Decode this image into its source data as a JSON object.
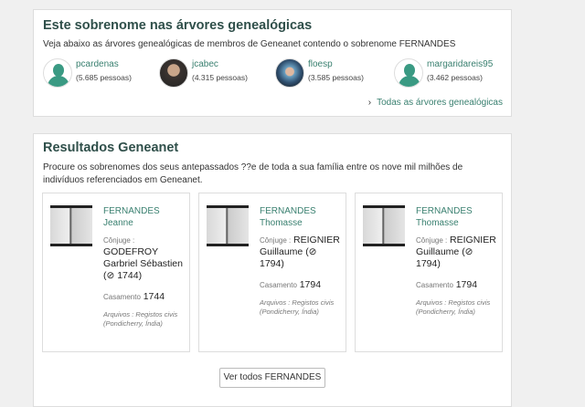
{
  "trees": {
    "title": "Este sobrenome nas árvores genealógicas",
    "description": "Veja abaixo as árvores genealógicas de membros de Geneanet contendo o sobrenome FERNANDES",
    "members": [
      {
        "name": "pcardenas",
        "count": "(5.685 pessoas)",
        "avatar": "default"
      },
      {
        "name": "jcabec",
        "count": "(4.315 pessoas)",
        "avatar": "photo"
      },
      {
        "name": "floesp",
        "count": "(3.585 pessoas)",
        "avatar": "photo"
      },
      {
        "name": "margaridareis95",
        "count": "(3.462 pessoas)",
        "avatar": "default"
      }
    ],
    "all_link": "Todas as árvores genealógicas"
  },
  "results": {
    "title": "Resultados Geneanet",
    "description": "Procure os sobrenomes dos seus antepassados ??e de toda a sua família entre os nove mil milhões de indivíduos referenciados em Geneanet.",
    "cards": [
      {
        "surname": "FERNANDES",
        "given": "Jeanne",
        "spouse_label": "Cônjuge :",
        "spouse": "GODEFROY Garbriel Sébastien (⊘ 1744)",
        "event_label": "Casamento",
        "event_year": "1744",
        "archive": "Arquivos : Registos civis (Pondicherry, Índia)"
      },
      {
        "surname": "FERNANDES",
        "given": "Thomasse",
        "spouse_label": "Cônjuge :",
        "spouse": "REIGNIER Guillaume (⊘ 1794)",
        "event_label": "Casamento",
        "event_year": "1794",
        "archive": "Arquivos : Registos civis (Pondicherry, Índia)"
      },
      {
        "surname": "FERNANDES",
        "given": "Thomasse",
        "spouse_label": "Cônjuge :",
        "spouse": "REIGNIER Guillaume (⊘ 1794)",
        "event_label": "Casamento",
        "event_year": "1794",
        "archive": "Arquivos : Registos civis (Pondicherry, Índia)"
      }
    ],
    "button": "Ver todos FERNANDES"
  }
}
